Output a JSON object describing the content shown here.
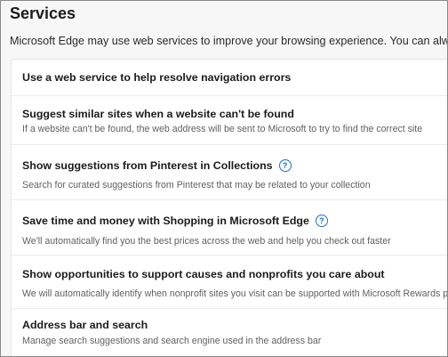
{
  "page": {
    "title": "Services",
    "description": "Microsoft Edge may use web services to improve your browsing experience. You can always choos"
  },
  "colors": {
    "help_icon": "#1a6fc7",
    "card_bg": "#ffffff",
    "page_bg": "#f7f7f7"
  },
  "settings": [
    {
      "title": "Use a web service to help resolve navigation errors",
      "subtitle": "",
      "help_icon": false
    },
    {
      "title": "Suggest similar sites when a website can't be found",
      "subtitle": "If a website can't be found, the web address will be sent to Microsoft to try to find the correct site",
      "help_icon": false
    },
    {
      "title": "Show suggestions from Pinterest in Collections",
      "subtitle": "Search for curated suggestions from Pinterest that may be related to your collection",
      "help_icon": true,
      "help_icon_name": "question-circle-icon",
      "help_glyph": "?"
    },
    {
      "title": "Save time and money with Shopping in Microsoft Edge",
      "subtitle": "We'll automatically find you the best prices across the web and help you check out faster",
      "help_icon": true,
      "help_icon_name": "question-circle-icon",
      "help_glyph": "?"
    },
    {
      "title": "Show opportunities to support causes and nonprofits you care about",
      "subtitle": "We will automatically identify when nonprofit sites you visit can be supported with Microsoft Rewards points or",
      "help_icon": false
    },
    {
      "title": "Address bar and search",
      "subtitle": "Manage search suggestions and search engine used in the address bar",
      "help_icon": false
    }
  ]
}
